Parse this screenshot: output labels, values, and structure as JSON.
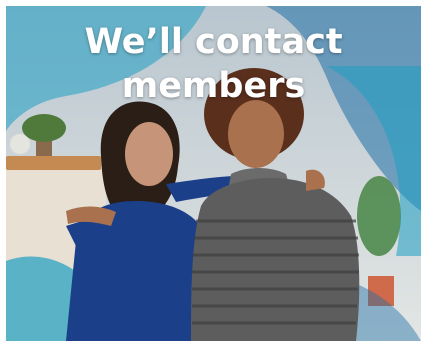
{
  "banner": {
    "headline_line1": "We’ll contact",
    "headline_line2": "members"
  },
  "colors": {
    "accent_teal": "#1e9ec2",
    "accent_blue": "#1f6fa6",
    "headline": "#ffffff"
  }
}
